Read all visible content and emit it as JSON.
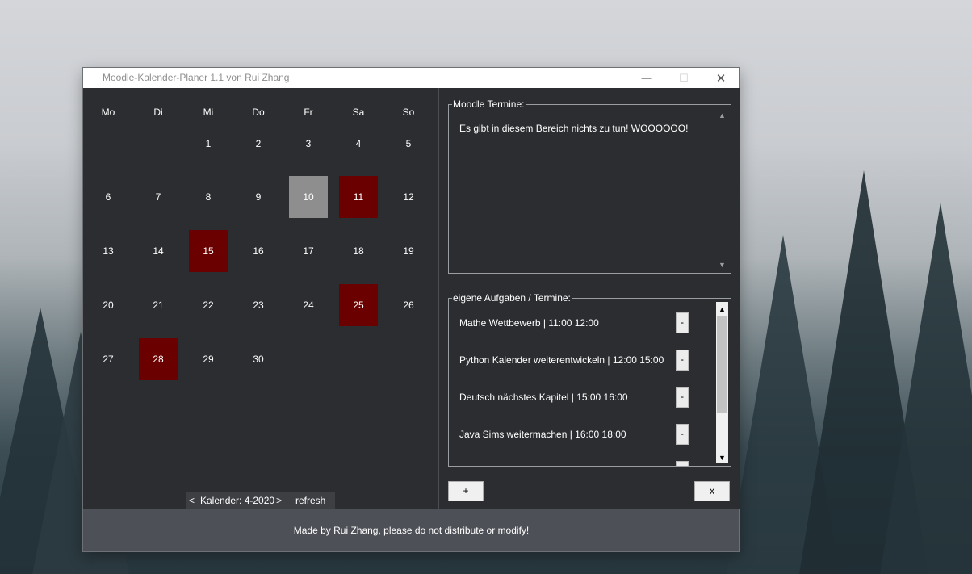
{
  "window": {
    "title": "Moodle-Kalender-Planer 1.1 von Rui Zhang",
    "controls": {
      "minimize": "—",
      "maximize": "☐",
      "close": "✕"
    }
  },
  "calendar": {
    "weekdays": [
      "Mo",
      "Di",
      "Mi",
      "Do",
      "Fr",
      "Sa",
      "So"
    ],
    "days": [
      "1",
      "2",
      "3",
      "4",
      "5",
      "6",
      "7",
      "8",
      "9",
      "10",
      "11",
      "12",
      "13",
      "14",
      "15",
      "16",
      "17",
      "18",
      "19",
      "20",
      "21",
      "22",
      "23",
      "24",
      "25",
      "26",
      "27",
      "28",
      "29",
      "30"
    ],
    "today": "10",
    "event_days": [
      "11",
      "15",
      "25",
      "28"
    ],
    "colors": {
      "today": "#8e8e8e",
      "event": "#6b0000"
    },
    "nav": {
      "prev": "<",
      "label": "Kalender: 4-2020",
      "next": ">",
      "refresh": "refresh"
    }
  },
  "moodle": {
    "legend": "Moodle Termine:",
    "message": "Es gibt in diesem Bereich nichts zu tun! WOOOOOO!"
  },
  "tasks": {
    "legend": "eigene Aufgaben / Termine:",
    "items": [
      {
        "text": "Mathe Wettbewerb | 11:00 12:00",
        "remove": "-"
      },
      {
        "text": "Python Kalender weiterentwickeln | 12:00 15:00",
        "remove": "-"
      },
      {
        "text": "Deutsch nächstes Kapitel | 15:00 16:00",
        "remove": "-"
      },
      {
        "text": "Java Sims weitermachen | 16:00 18:00",
        "remove": "-"
      }
    ],
    "add_label": "+",
    "close_label": "x"
  },
  "footer": {
    "text": "Made by Rui Zhang, please do not distribute or modify!"
  }
}
